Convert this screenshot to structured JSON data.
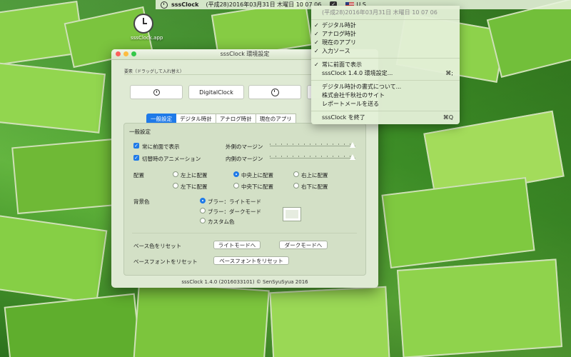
{
  "menubar": {
    "app_name": "sssClock",
    "datetime": "(平成28)2016年03月31日 木曜日 10 07 06",
    "input_source": "U.S."
  },
  "desktop_icon": {
    "label": "sssClock.app"
  },
  "window": {
    "title": "sssClock 環境設定",
    "elements_label": "要素（ドラッグして入れ替え）",
    "elements": {
      "digital_label": "DigitalClock"
    },
    "tabs": [
      "一般設定",
      "デジタル時計",
      "アナログ時計",
      "現在のアプリ"
    ],
    "general": {
      "section_title": "一般設定",
      "always_on_top": "常に前面で表示",
      "switch_animation": "切替時のアニメーション",
      "outer_margin": "外側のマージン",
      "inner_margin": "内側のマージン",
      "placement_label": "配置",
      "placements": [
        "左上に配置",
        "中央上に配置",
        "右上に配置",
        "左下に配置",
        "中央下に配置",
        "右下に配置"
      ],
      "placement_selected": "中央上に配置",
      "bg_label": "背景色",
      "bg_options": [
        "ブラー：ライトモード",
        "ブラー：ダークモード",
        "カスタム色"
      ],
      "bg_selected": "ブラー：ライトモード",
      "reset_base_color_label": "ベース色をリセット",
      "light_mode_button": "ライトモードへ",
      "dark_mode_button": "ダークモードへ",
      "reset_base_font_label": "ベースフォントをリセット",
      "reset_base_font_button": "ベースフォントをリセット"
    },
    "footer": "sssClock 1.4.0 (2016033101) © SenSyuSyua 2016"
  },
  "menu": {
    "header": "(平成28)2016年03月31日 木曜日 10 07 06",
    "items": [
      {
        "label": "デジタル時計",
        "check": "✓"
      },
      {
        "label": "アナログ時計",
        "check": "✓"
      },
      {
        "label": "現在のアプリ",
        "check": "✓"
      },
      {
        "label": "入力ソース",
        "check": "✓"
      },
      {
        "label": "常に前面で表示",
        "check": "✓"
      },
      {
        "label": "sssClock 1.4.0 環境設定...",
        "shortcut": "⌘;"
      },
      {
        "label": "デジタル時計の書式について..."
      },
      {
        "label": "株式会社千秋社のサイト"
      },
      {
        "label": "レポートメールを送る"
      },
      {
        "label": "sssClock を終了",
        "shortcut": "⌘Q"
      }
    ]
  },
  "colors": {
    "accent": "#1f7ae8",
    "field_green": "#8cd14a"
  }
}
